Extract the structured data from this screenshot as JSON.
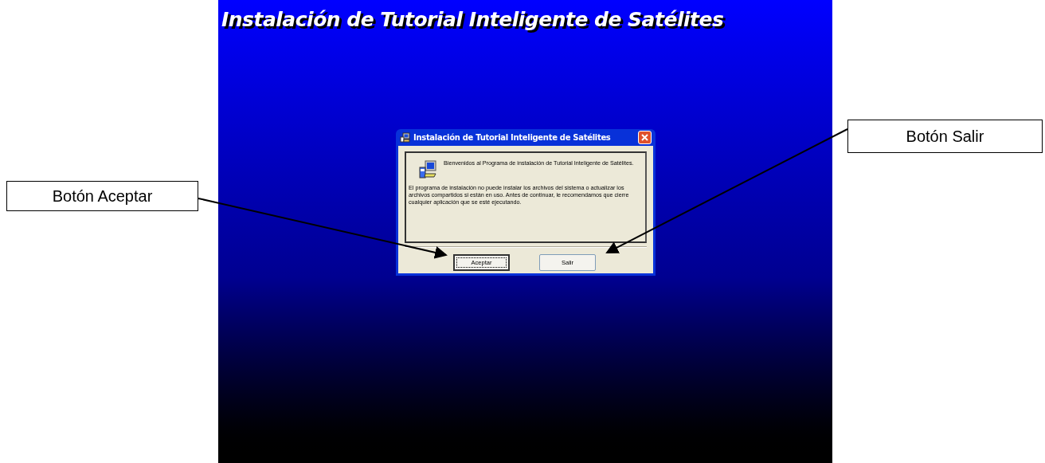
{
  "screen_title": "Instalación de Tutorial Inteligente de Satélites",
  "dialog": {
    "title": "Instalación de Tutorial Inteligente de Satélites",
    "intro": "Bienvenidos al Programa de instalación de Tutorial Inteligente de Satélites.",
    "message": "El programa de instalación no puede instalar los archivos del sistema o actualizar los archivos compartidos si están en uso. Antes de continuar, le recomendamos que cierre cualquier aplicación que se esté ejecutando.",
    "buttons": [
      {
        "label": "Aceptar",
        "focused": true
      },
      {
        "label": "Salir",
        "focused": false
      }
    ]
  },
  "callouts": [
    {
      "label": "Botón Aceptar"
    },
    {
      "label": "Botón Salir"
    }
  ]
}
